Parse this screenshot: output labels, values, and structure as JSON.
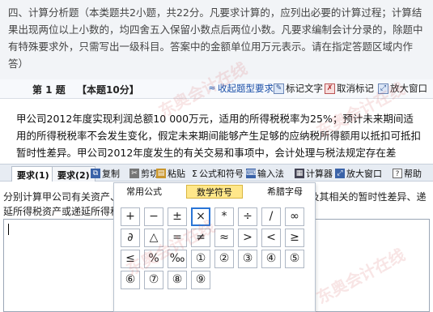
{
  "instructions": "四、计算分析题（本类题共2小题，共22分。凡要求计算的，应列出必要的计算过程；计算结果出现两位以上小数的，均四舍五入保留小数点后两位小数。凡要求编制会计分录的，除题中有特殊要求外，只需写出一级科目。答案中的金额单位用万元表示。请在指定答题区域内作答）",
  "question_bar": {
    "number": "第 1 题",
    "score": "【本题10分】",
    "collapse": "收起题型要求",
    "mark_text": "标记文字",
    "unmark": "取消标记",
    "enlarge": "放大窗口"
  },
  "question_body": "甲公司2012年度实现利润总额10 000万元，适用的所得税税率为25%；预计未来期间适用的所得税税率不会发生变化，假定未来期间能够产生足够的应纳税所得额用以抵扣可抵扣暂时性差异。甲公司2012年度发生的有关交易和事项中，会计处理与税法规定存在差",
  "answer_tabs": [
    "要求(1)",
    "要求(2)"
  ],
  "answer_toolbar": {
    "copy": "复制",
    "cut": "剪切",
    "paste": "粘贴",
    "formula": "公式和符号",
    "input_method": "输入法",
    "calculator": "计算器",
    "enlarge": "放大窗口",
    "help": "帮助"
  },
  "answer_prompt": "分别计算甲公司有关资产、负债在2012年年末的账面价值、计税基础，及其相关的暂时性差异、递延所得税资产或递延所得税负债的余额。",
  "symbol_panel": {
    "tabs": [
      "常用公式",
      "数学符号",
      "希腊字母"
    ],
    "active_tab_index": 1,
    "selected_symbol": "×",
    "symbols": [
      "+",
      "−",
      "±",
      "×",
      "*",
      "÷",
      "/",
      "∞",
      "∂",
      "△",
      "=",
      "≠",
      "≈",
      ">",
      "<",
      "≥",
      "≤",
      "%",
      "‰",
      "①",
      "②",
      "③",
      "④",
      "⑤",
      "⑥",
      "⑦",
      "⑧",
      "⑨"
    ]
  },
  "watermarks": [
    "东奥会计在线",
    "www.dongao.com"
  ]
}
